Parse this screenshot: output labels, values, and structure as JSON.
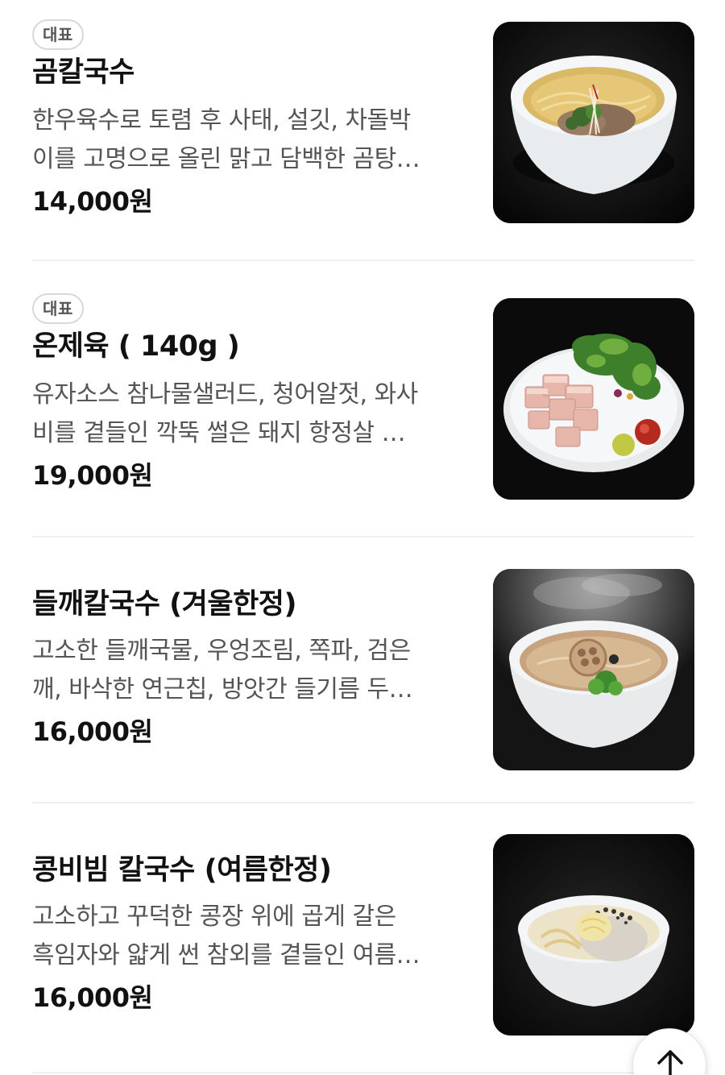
{
  "menu": {
    "items": [
      {
        "badge": "대표",
        "name": "곰칼국수",
        "desc_line1": "한우육수로 토렴 후 사태, 설깃, 차돌박",
        "desc_line2": "이를 고명으로 올린 맑고 담백한 곰탕…",
        "price": "14,000원",
        "image": "clear-broth-noodle-bowl"
      },
      {
        "badge": "대표",
        "name": "온제육 ( 140g )",
        "desc_line1": "유자소스 참나물샐러드, 청어알젓, 와사",
        "desc_line2": "비를 곁들인 깍뚝 썰은 돼지 항정살 …",
        "price": "19,000원",
        "image": "pork-salad-plate"
      },
      {
        "name": "들깨칼국수 (겨울한정)",
        "desc_line1": "고소한 들깨국물, 우엉조림, 쪽파, 검은",
        "desc_line2": "깨, 바삭한 연근칩, 방앗간 들기름 두…",
        "price": "16,000원",
        "image": "perilla-noodle-bowl"
      },
      {
        "name": "콩비빔 칼국수 (여름한정)",
        "desc_line1": "고소하고 꾸덕한 콩장 위에 곱게 갈은",
        "desc_line2": "흑임자와 얇게 썬 참외를 곁들인 여름…",
        "price": "16,000원",
        "image": "bean-noodle-bowl"
      }
    ]
  },
  "scroll_top": {
    "icon": "arrow-up-icon"
  }
}
